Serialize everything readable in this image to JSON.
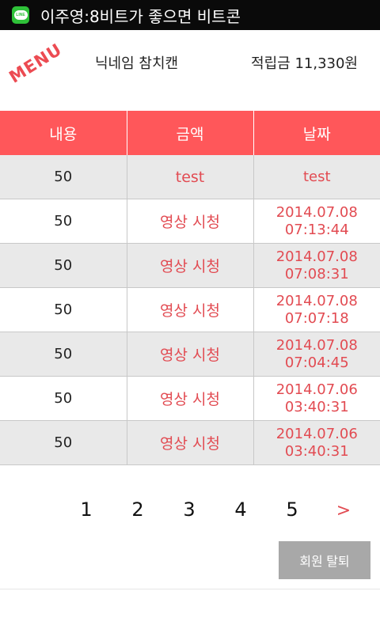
{
  "status_bar": {
    "app_icon": "line-icon",
    "app_icon_text": "LINE",
    "notification_text": "이주영:8비트가 좋으면 비트콘"
  },
  "header": {
    "menu_label": "MENU",
    "nickname": "닉네임 참치캔",
    "points": "적립금 11,330원"
  },
  "table": {
    "columns": [
      "내용",
      "금액",
      "날짜"
    ],
    "rows": [
      {
        "amount": "50",
        "content": "test",
        "date1": "test",
        "date2": ""
      },
      {
        "amount": "50",
        "content": "영상 시청",
        "date1": "2014.07.08",
        "date2": "07:13:44"
      },
      {
        "amount": "50",
        "content": "영상 시청",
        "date1": "2014.07.08",
        "date2": "07:08:31"
      },
      {
        "amount": "50",
        "content": "영상 시청",
        "date1": "2014.07.08",
        "date2": "07:07:18"
      },
      {
        "amount": "50",
        "content": "영상 시청",
        "date1": "2014.07.08",
        "date2": "07:04:45"
      },
      {
        "amount": "50",
        "content": "영상 시청",
        "date1": "2014.07.06",
        "date2": "03:40:31"
      },
      {
        "amount": "50",
        "content": "영상 시청",
        "date1": "2014.07.06",
        "date2": "03:40:31"
      }
    ]
  },
  "pagination": {
    "pages": [
      "1",
      "2",
      "3",
      "4",
      "5"
    ],
    "next_label": ">"
  },
  "withdraw_label": "회원 탈퇴",
  "colors": {
    "header_red": "#ff575a",
    "text_red": "#e24b52",
    "row_shade": "#e9e9e9"
  }
}
